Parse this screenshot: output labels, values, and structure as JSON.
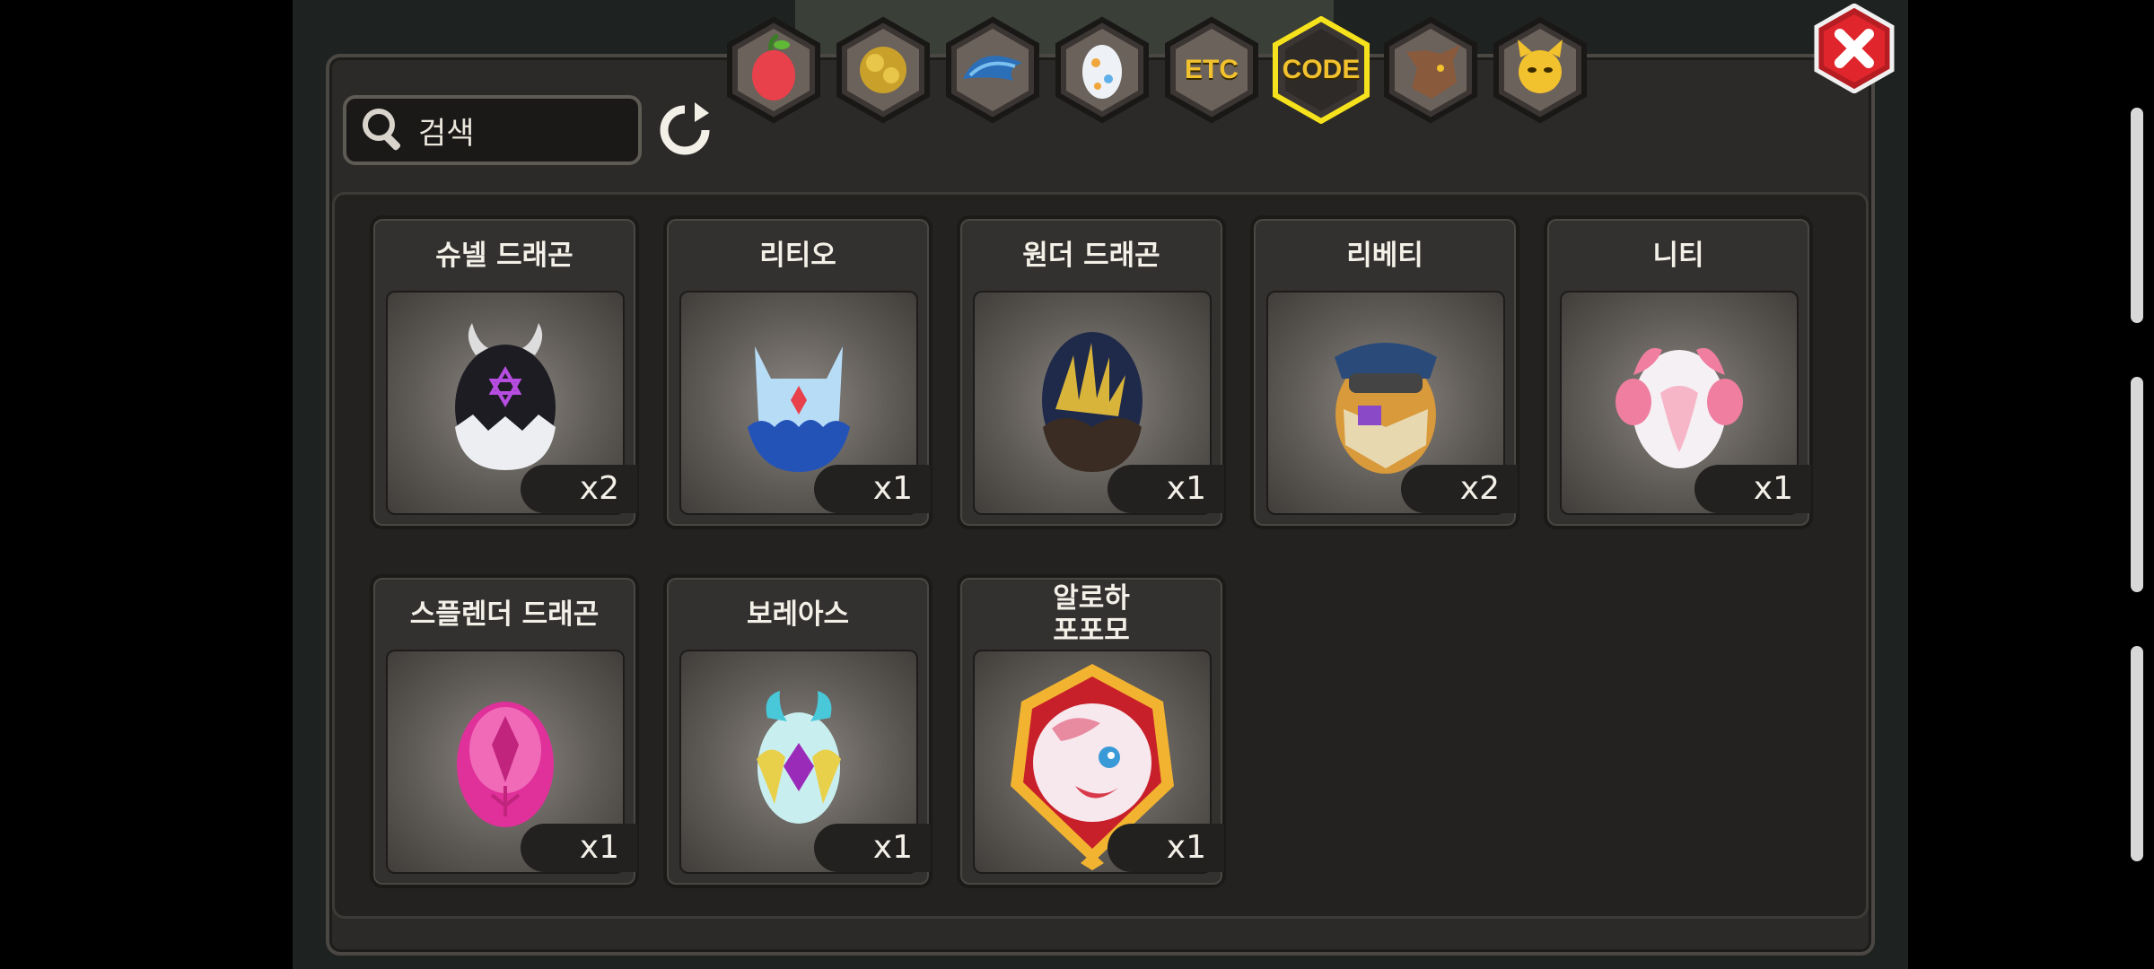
{
  "search": {
    "placeholder": "검색"
  },
  "tabs": [
    {
      "name": "fruit-tab",
      "label": ""
    },
    {
      "name": "gold-tab",
      "label": ""
    },
    {
      "name": "dragon-wing-tab",
      "label": ""
    },
    {
      "name": "egg-tab",
      "label": ""
    },
    {
      "name": "etc-tab",
      "label": "ETC"
    },
    {
      "name": "code-tab",
      "label": "CODE",
      "active": true
    },
    {
      "name": "wolf-tab",
      "label": ""
    },
    {
      "name": "demon-tab",
      "label": ""
    }
  ],
  "items": [
    {
      "name": "슈넬 드래곤",
      "count": "x2"
    },
    {
      "name": "리티오",
      "count": "x1"
    },
    {
      "name": "원더 드래곤",
      "count": "x1"
    },
    {
      "name": "리베티",
      "count": "x2"
    },
    {
      "name": "니티",
      "count": "x1"
    },
    {
      "name": "스플렌더 드래곤",
      "count": "x1"
    },
    {
      "name": "보레아스",
      "count": "x1"
    },
    {
      "name": "알로하\n포포모",
      "count": "x1"
    }
  ],
  "colors": {
    "active_tab_border": "#f5e21c",
    "accent_text": "#f2c12e",
    "close_red": "#d8232a"
  }
}
